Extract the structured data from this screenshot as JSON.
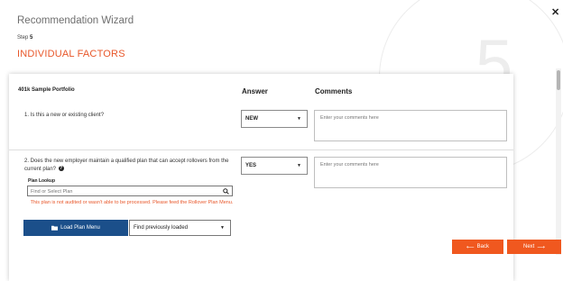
{
  "window": {
    "title": "Recommendation Wizard",
    "close_icon": "close-x-icon"
  },
  "step": {
    "label": "Step",
    "number": "5"
  },
  "section_title": "INDIVIDUAL FACTORS",
  "background_number": "5",
  "table": {
    "portfolio_header": "401k Sample Portfolio",
    "answer_header": "Answer",
    "comments_header": "Comments"
  },
  "questions": [
    {
      "text": "1. Is this a new or existing client?",
      "answer": "NEW",
      "comment_placeholder": "Enter your comments here"
    },
    {
      "text": "2. Does the new employer maintain a qualified plan that can accept rollovers from the current plan?",
      "answer": "YES",
      "comment_placeholder": "Enter your comments here"
    }
  ],
  "plan_lookup": {
    "label": "Plan Lookup",
    "placeholder": "Find or Select Plan",
    "warning": "This plan is not audited or wasn't able to be processed. Please feed the Rollover Plan Menu.",
    "load_button": "Load Plan Menu",
    "find_previous": "Find previously loaded"
  },
  "nav": {
    "back": "Back",
    "next": "Next"
  },
  "colors": {
    "accent": "#f0581f",
    "primary": "#1b4f8a",
    "section_title": "#e8572a"
  }
}
